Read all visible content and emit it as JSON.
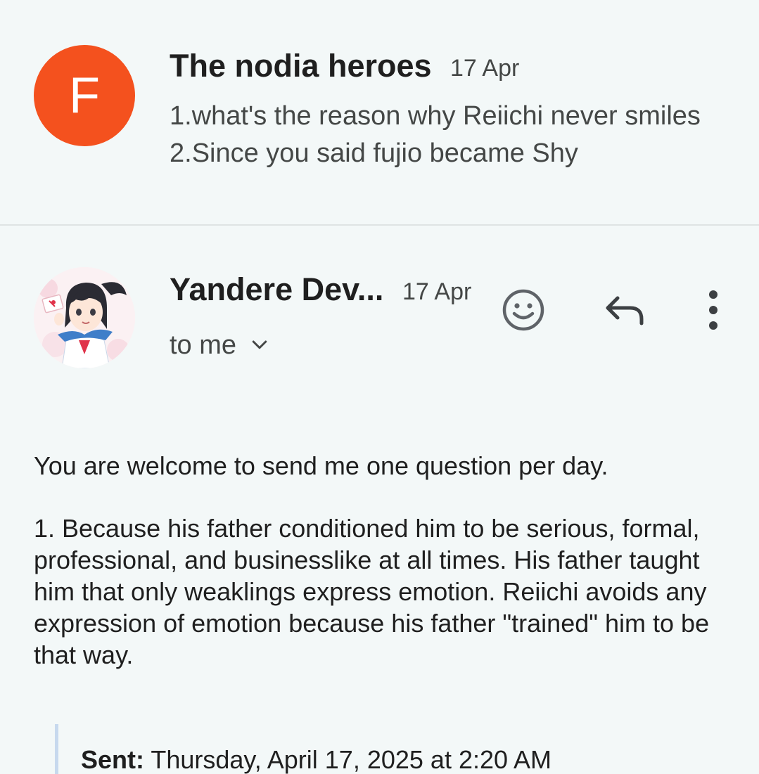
{
  "colors": {
    "background": "#f3f8f8",
    "avatar_orange": "#f4511e",
    "primary_text": "#1f1f1f",
    "secondary_text": "#444746",
    "icon_gray": "#5f6368"
  },
  "collapsed_message": {
    "avatar_letter": "F",
    "sender": "The nodia heroes",
    "date": "17 Apr",
    "snippet": "1.what's the reason why Reiichi never smiles 2.Since you said fujio became Shy"
  },
  "expanded_message": {
    "avatar_icon": "anime-character-avatar",
    "sender": "Yandere Dev...",
    "date": "17 Apr",
    "recipients_label": "to me",
    "actions": {
      "emoji_icon": "add-reaction-icon",
      "reply_icon": "reply-icon",
      "more_icon": "more-vert-icon"
    },
    "body": {
      "line1": "You are welcome to send me one question per day.",
      "paragraph2": "1. Because his father conditioned him to be serious, formal, professional, and businesslike at all times. His father taught him that only weaklings express emotion. Reiichi avoids any expression of emotion because his father \"trained\" him to be that way."
    },
    "quoted": {
      "sent_label": "Sent:",
      "sent_value": "Thursday, April 17, 2025 at 2:20 AM"
    }
  }
}
